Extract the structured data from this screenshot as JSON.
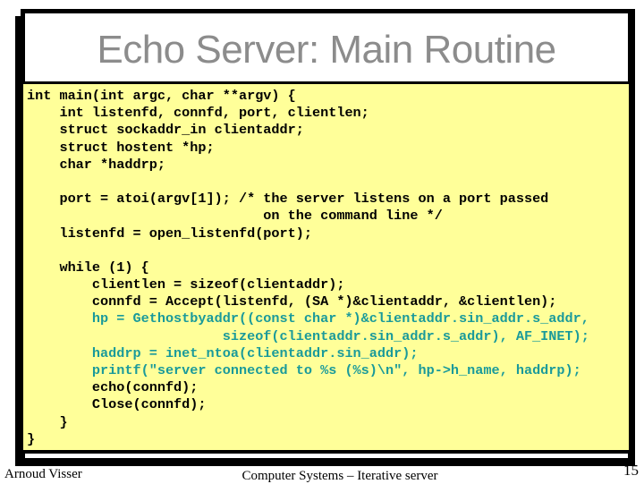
{
  "slide": {
    "title": "Echo Server: Main Routine",
    "code_lines": [
      {
        "text": "int main(int argc, char **argv) {",
        "highlight": false
      },
      {
        "text": "    int listenfd, connfd, port, clientlen;",
        "highlight": false
      },
      {
        "text": "    struct sockaddr_in clientaddr;",
        "highlight": false
      },
      {
        "text": "    struct hostent *hp;",
        "highlight": false
      },
      {
        "text": "    char *haddrp;",
        "highlight": false
      },
      {
        "text": "",
        "highlight": false
      },
      {
        "text": "    port = atoi(argv[1]); /* the server listens on a port passed",
        "highlight": false
      },
      {
        "text": "                             on the command line */",
        "highlight": false
      },
      {
        "text": "    listenfd = open_listenfd(port);",
        "highlight": false
      },
      {
        "text": "",
        "highlight": false
      },
      {
        "text": "    while (1) {",
        "highlight": false
      },
      {
        "text": "        clientlen = sizeof(clientaddr);",
        "highlight": false
      },
      {
        "text": "        connfd = Accept(listenfd, (SA *)&clientaddr, &clientlen);",
        "highlight": false
      },
      {
        "text": "        hp = Gethostbyaddr((const char *)&clientaddr.sin_addr.s_addr,",
        "highlight": true
      },
      {
        "text": "                        sizeof(clientaddr.sin_addr.s_addr), AF_INET);",
        "highlight": true
      },
      {
        "text": "        haddrp = inet_ntoa(clientaddr.sin_addr);",
        "highlight": true
      },
      {
        "text": "        printf(\"server connected to %s (%s)\\n\", hp->h_name, haddrp);",
        "highlight": true
      },
      {
        "text": "        echo(connfd);",
        "highlight": false
      },
      {
        "text": "        Close(connfd);",
        "highlight": false
      },
      {
        "text": "    }",
        "highlight": false
      },
      {
        "text": "}",
        "highlight": false
      }
    ],
    "highlight_color": "#1a9a9a",
    "background_color": "#ffff99"
  },
  "footer": {
    "author": "Arnoud Visser",
    "course": "Computer Systems – Iterative server",
    "page_number": "15"
  }
}
